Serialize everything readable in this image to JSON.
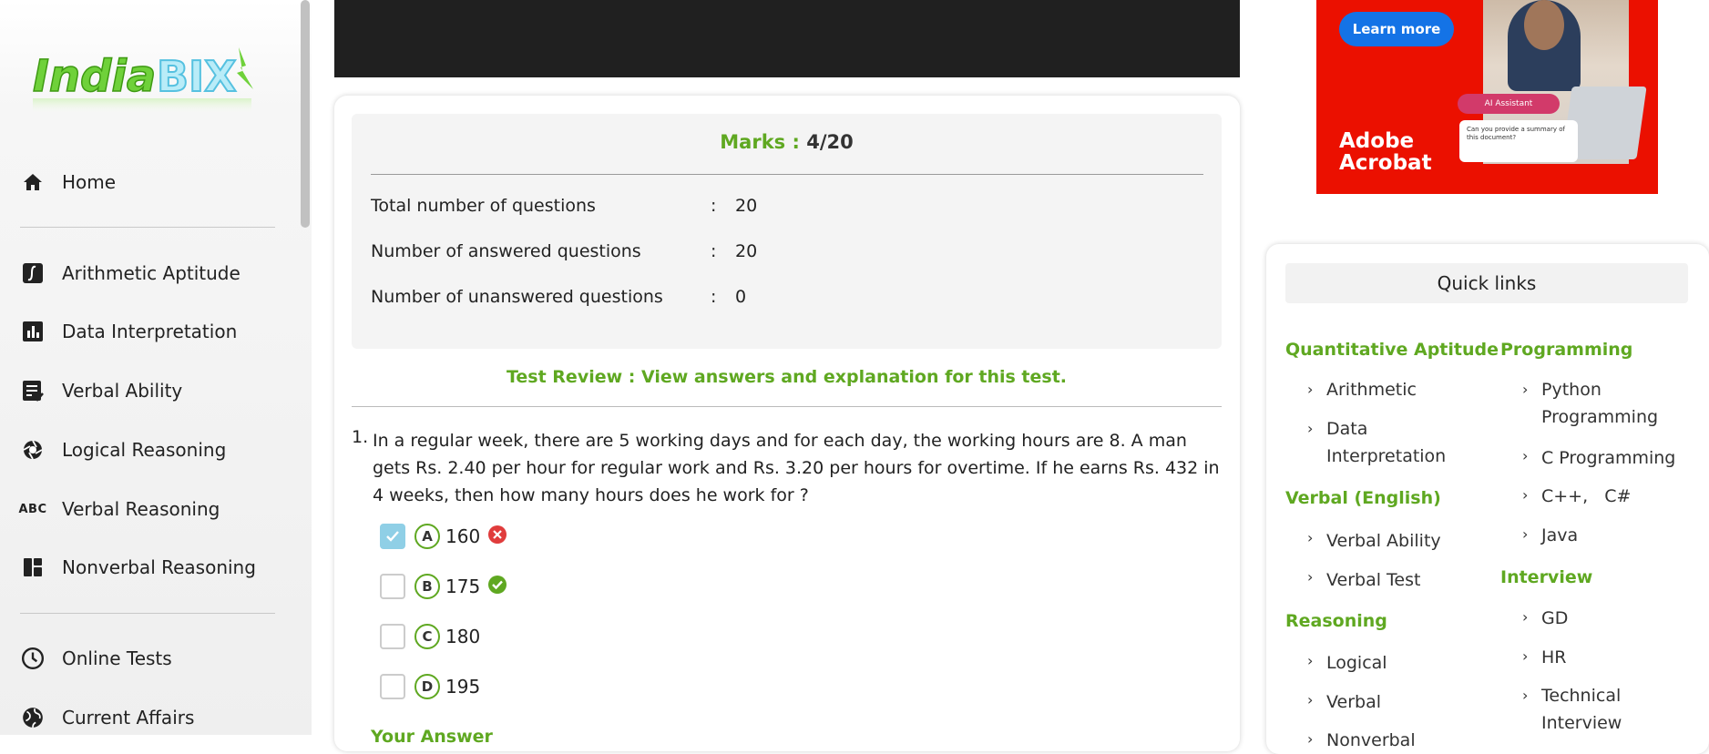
{
  "logo": {
    "text": "IndiaBIX"
  },
  "sidebar": {
    "items": [
      {
        "label": "Home",
        "icon": "home-icon"
      },
      {
        "label": "Arithmetic Aptitude",
        "icon": "integral-icon"
      },
      {
        "label": "Data Interpretation",
        "icon": "bar-chart-icon"
      },
      {
        "label": "Verbal Ability",
        "icon": "checklist-icon"
      },
      {
        "label": "Logical Reasoning",
        "icon": "aperture-icon"
      },
      {
        "label": "Verbal Reasoning",
        "icon": "abc-icon"
      },
      {
        "label": "Nonverbal Reasoning",
        "icon": "dashboard-icon"
      },
      {
        "label": "Online Tests",
        "icon": "clock-icon"
      },
      {
        "label": "Current Affairs",
        "icon": "globe-icon"
      }
    ]
  },
  "result": {
    "marks_label": "Marks :",
    "marks_value": "4/20",
    "rows": [
      {
        "label": "Total number of questions",
        "colon": ":",
        "value": "20"
      },
      {
        "label": "Number of answered questions",
        "colon": ":",
        "value": "20"
      },
      {
        "label": "Number of unanswered questions",
        "colon": ":",
        "value": "0"
      }
    ],
    "review_link": "Test Review : View answers and explanation for this test."
  },
  "question": {
    "number": "1.",
    "text": "In a regular week, there are 5 working days and for each day, the working hours are 8. A man gets Rs. 2.40 per hour for regular work and Rs. 3.20 per hours for overtime. If he earns Rs. 432 in 4 weeks, then how many hours does he work for ?",
    "options": [
      {
        "letter": "A",
        "value": "160",
        "checked": true,
        "status": "wrong"
      },
      {
        "letter": "B",
        "value": "175",
        "checked": false,
        "status": "correct"
      },
      {
        "letter": "C",
        "value": "180",
        "checked": false,
        "status": ""
      },
      {
        "letter": "D",
        "value": "195",
        "checked": false,
        "status": ""
      }
    ],
    "your_answer_label": "Your Answer"
  },
  "ad": {
    "button": "Learn more",
    "chip": "AI Assistant",
    "bubble": "Can you provide a summary of this document?",
    "brand_line1": "Adobe",
    "brand_line2": "Acrobat"
  },
  "quick_links": {
    "title": "Quick links",
    "left": [
      {
        "category": "Quantitative Aptitude",
        "links": [
          "Arithmetic",
          "Data Interpretation"
        ]
      },
      {
        "category": "Verbal (English)",
        "links": [
          "Verbal Ability",
          "Verbal Test"
        ]
      },
      {
        "category": "Reasoning",
        "links": [
          "Logical",
          "Verbal",
          "Nonverbal"
        ]
      }
    ],
    "right": [
      {
        "category": "Programming",
        "links": [
          "Python Programming",
          "C Programming",
          "C++,   C#",
          "Java"
        ]
      },
      {
        "category": "Interview",
        "links": [
          "GD",
          "HR",
          "Technical Interview"
        ]
      }
    ]
  },
  "colors": {
    "accent_green": "#5fa821",
    "check_blue": "#8fcfe6",
    "wrong_red": "#e03c3c",
    "correct_green": "#5fa821"
  }
}
